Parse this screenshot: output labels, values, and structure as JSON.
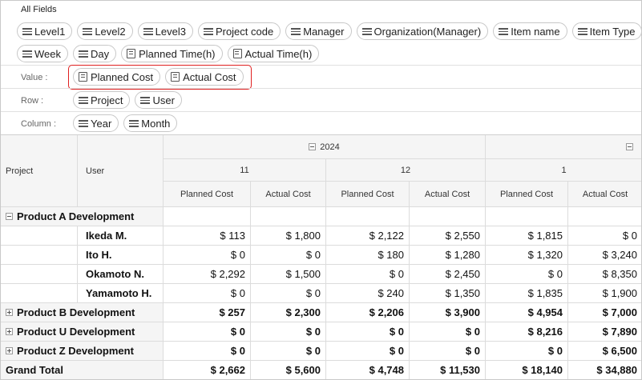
{
  "field_list": {
    "title": "All Fields",
    "row1": [
      "Level1",
      "Level2",
      "Level3",
      "Project code",
      "Manager",
      "Organization(Manager)",
      "Item name",
      "Item Type"
    ],
    "row2": [
      "Week",
      "Day",
      "Planned Time(h)",
      "Actual Time(h)"
    ]
  },
  "zones": {
    "value": {
      "label": "Value :",
      "fields": [
        "Planned Cost",
        "Actual Cost"
      ]
    },
    "row": {
      "label": "Row :",
      "fields": [
        "Project",
        "User"
      ]
    },
    "column": {
      "label": "Column :",
      "fields": [
        "Year",
        "Month"
      ]
    }
  },
  "pivot": {
    "corner": {
      "project": "Project",
      "user": "User"
    },
    "year": "2024",
    "months": [
      "11",
      "12",
      "1"
    ],
    "measures": [
      "Planned Cost",
      "Actual Cost"
    ],
    "rows": [
      {
        "project": "Product A Development",
        "user": "",
        "values": [
          "",
          "",
          "",
          "",
          "",
          ""
        ],
        "state": "collapse",
        "bold": false
      },
      {
        "project": "",
        "user": "Ikeda M.",
        "values": [
          "$ 113",
          "$ 1,800",
          "$ 2,122",
          "$ 2,550",
          "$ 1,815",
          "$ 0"
        ],
        "state": "",
        "bold": false
      },
      {
        "project": "",
        "user": "Ito H.",
        "values": [
          "$ 0",
          "$ 0",
          "$ 180",
          "$ 1,280",
          "$ 1,320",
          "$ 3,240"
        ],
        "state": "",
        "bold": false
      },
      {
        "project": "",
        "user": "Okamoto N.",
        "values": [
          "$ 2,292",
          "$ 1,500",
          "$ 0",
          "$ 2,450",
          "$ 0",
          "$ 8,350"
        ],
        "state": "",
        "bold": false
      },
      {
        "project": "",
        "user": "Yamamoto H.",
        "values": [
          "$ 0",
          "$ 0",
          "$ 240",
          "$ 1,350",
          "$ 1,835",
          "$ 1,900"
        ],
        "state": "",
        "bold": false
      },
      {
        "project": "Product B Development",
        "user": "",
        "values": [
          "$ 257",
          "$ 2,300",
          "$ 2,206",
          "$ 3,900",
          "$ 4,954",
          "$ 7,000"
        ],
        "state": "expand",
        "bold": true
      },
      {
        "project": "Product U Development",
        "user": "",
        "values": [
          "$ 0",
          "$ 0",
          "$ 0",
          "$ 0",
          "$ 8,216",
          "$ 7,890"
        ],
        "state": "expand",
        "bold": true
      },
      {
        "project": "Product Z Development",
        "user": "",
        "values": [
          "$ 0",
          "$ 0",
          "$ 0",
          "$ 0",
          "$ 0",
          "$ 6,500"
        ],
        "state": "expand",
        "bold": true
      },
      {
        "project": "Grand Total",
        "user": "",
        "values": [
          "$ 2,662",
          "$ 5,600",
          "$ 4,748",
          "$ 11,530",
          "$ 18,140",
          "$ 34,880"
        ],
        "state": "total",
        "bold": true
      }
    ]
  },
  "colors": {
    "highlight": "#e02020"
  }
}
